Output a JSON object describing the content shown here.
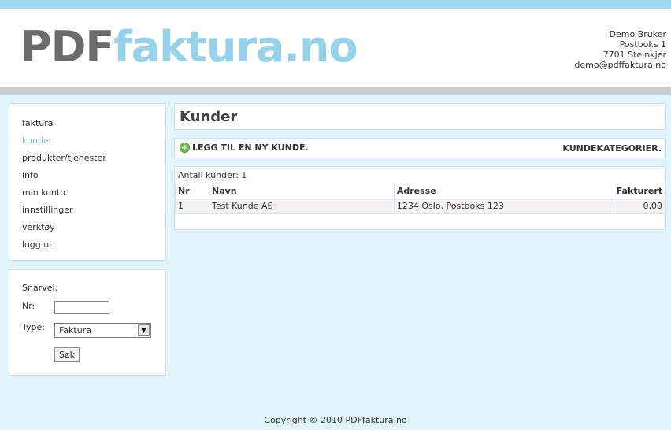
{
  "header": {
    "logo_part1": "PDF",
    "logo_part2": "faktura.no",
    "company_lines": [
      "Demo Bruker",
      "Postboks 1",
      "7701 Steinkjer",
      "demo@pdffaktura.no"
    ]
  },
  "menu": {
    "items": [
      "faktura",
      "kunder",
      "produkter/tjenester",
      "info",
      "min konto",
      "innstillinger",
      "verktøy",
      "logg ut"
    ],
    "active_index": 1
  },
  "shortcut": {
    "title": "Snarvei:",
    "nr_label": "Nr:",
    "nr_value": "",
    "type_label": "Type:",
    "type_selected": "Faktura",
    "search_button": "Søk"
  },
  "main": {
    "title": "Kunder",
    "add_link": "LEGG TIL EN NY KUNDE.",
    "categories_link": "KUNDEKATEGORIER.",
    "count_text": "Antall kunder: 1",
    "columns": [
      "Nr",
      "Navn",
      "Adresse",
      "Fakturert"
    ],
    "rows": [
      [
        "1",
        "Test Kunde AS",
        "1234 Oslo, Postboks 123",
        "0,00"
      ]
    ]
  },
  "footer": "Copyright © 2010 PDFfaktura.no",
  "colors": {
    "background": "#e2f4fb",
    "accent": "#96d2ea",
    "logo_gray": "#6b6b6b",
    "active_menu": "#7fc6e3"
  }
}
